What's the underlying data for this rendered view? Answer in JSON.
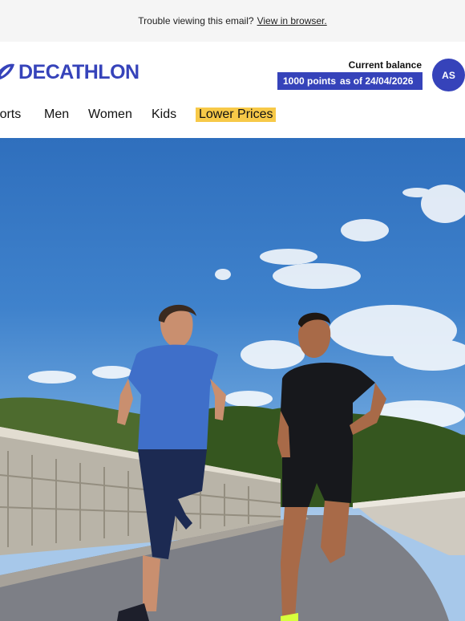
{
  "topbar": {
    "text": "Trouble viewing this email?",
    "link": "View in browser."
  },
  "header": {
    "logo_text": "DECATHLON",
    "balance_title": "Current balance",
    "points": "1000 points",
    "as_of": "as of 24/04/2026",
    "avatar_initials": "AS"
  },
  "nav": {
    "items": [
      "Sports",
      "Men",
      "Women",
      "Kids"
    ],
    "sale_item": "Lower Prices"
  },
  "hero": {
    "image_description_icon": "runners-photo"
  },
  "colors": {
    "brand": "#3643ba",
    "sale_highlight": "#f7c948",
    "topbar_bg": "#f5f5f5"
  }
}
